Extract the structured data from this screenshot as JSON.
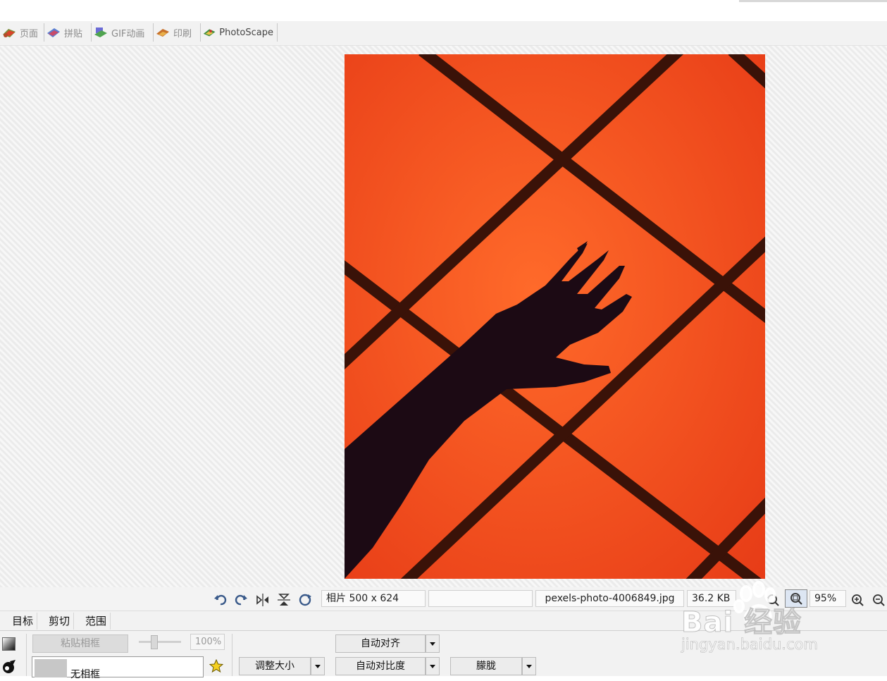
{
  "tabs": [
    {
      "label": "页面",
      "icon": "page-icon"
    },
    {
      "label": "拼贴",
      "icon": "combine-icon"
    },
    {
      "label": "GIF动画",
      "icon": "gif-icon"
    },
    {
      "label": "印刷",
      "icon": "print-icon"
    },
    {
      "label": "PhotoScape",
      "icon": "photoscape-icon",
      "active": true
    }
  ],
  "statusbar": {
    "photo_size": "相片 500 x 624",
    "empty_field": "",
    "filename": "pexels-photo-4006849.jpg",
    "filesize": "36.2 KB",
    "zoom": "95%"
  },
  "lower_tabs": [
    "目标",
    "剪切",
    "范围"
  ],
  "panel": {
    "paste_frame": "粘贴相框",
    "opacity": "100%",
    "frame_select": "无相框",
    "resize": "调整大小",
    "auto_level": "自动对齐",
    "auto_contrast": "自动对比度",
    "blur": "朦胧"
  },
  "watermark": {
    "text": "Bai 经验",
    "sub": "jingyan.baidu.com"
  },
  "colors": {
    "photo_orange": "#f04a1c",
    "grout": "#3a1208",
    "shadow": "#1c0a14"
  }
}
